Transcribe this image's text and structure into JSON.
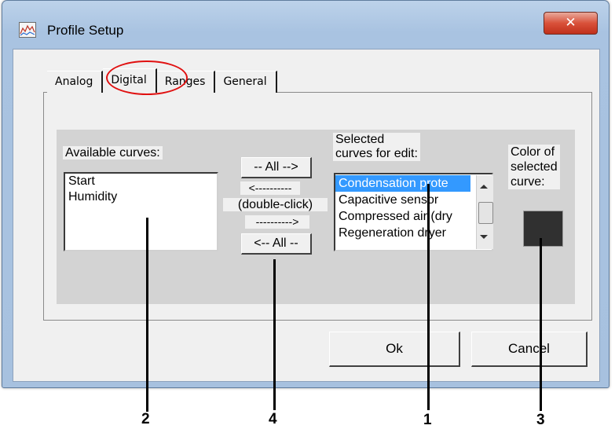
{
  "window": {
    "title": "Profile Setup",
    "close_glyph": "✕",
    "title_icon": "chart-icon"
  },
  "tabs": [
    {
      "label": "Analog",
      "active": false
    },
    {
      "label": "Digital",
      "active": true
    },
    {
      "label": "Ranges",
      "active": false
    },
    {
      "label": "General",
      "active": false
    }
  ],
  "available": {
    "label": "Available curves:",
    "items": [
      "Start",
      "Humidity"
    ]
  },
  "transfer": {
    "add_all": "-- All -->",
    "left_arrow": "<----------",
    "hint": "(double-click)",
    "right_arrow": "---------->",
    "remove_all": "<-- All --"
  },
  "selected": {
    "label_line1": "Selected",
    "label_line2": "curves for edit:",
    "items": [
      "Condensation prote",
      "Capacitive sensor",
      "Compressed air (dry",
      "Regeneration dryer"
    ],
    "selected_index": 0
  },
  "color": {
    "label_line1": "Color of",
    "label_line2": "selected",
    "label_line3": "curve:",
    "value": "#303030"
  },
  "buttons": {
    "ok": "Ok",
    "cancel": "Cancel"
  },
  "callouts": [
    "2",
    "4",
    "1",
    "3"
  ],
  "colors": {
    "highlight_ring": "#e01010",
    "selection": "#3399ff"
  }
}
